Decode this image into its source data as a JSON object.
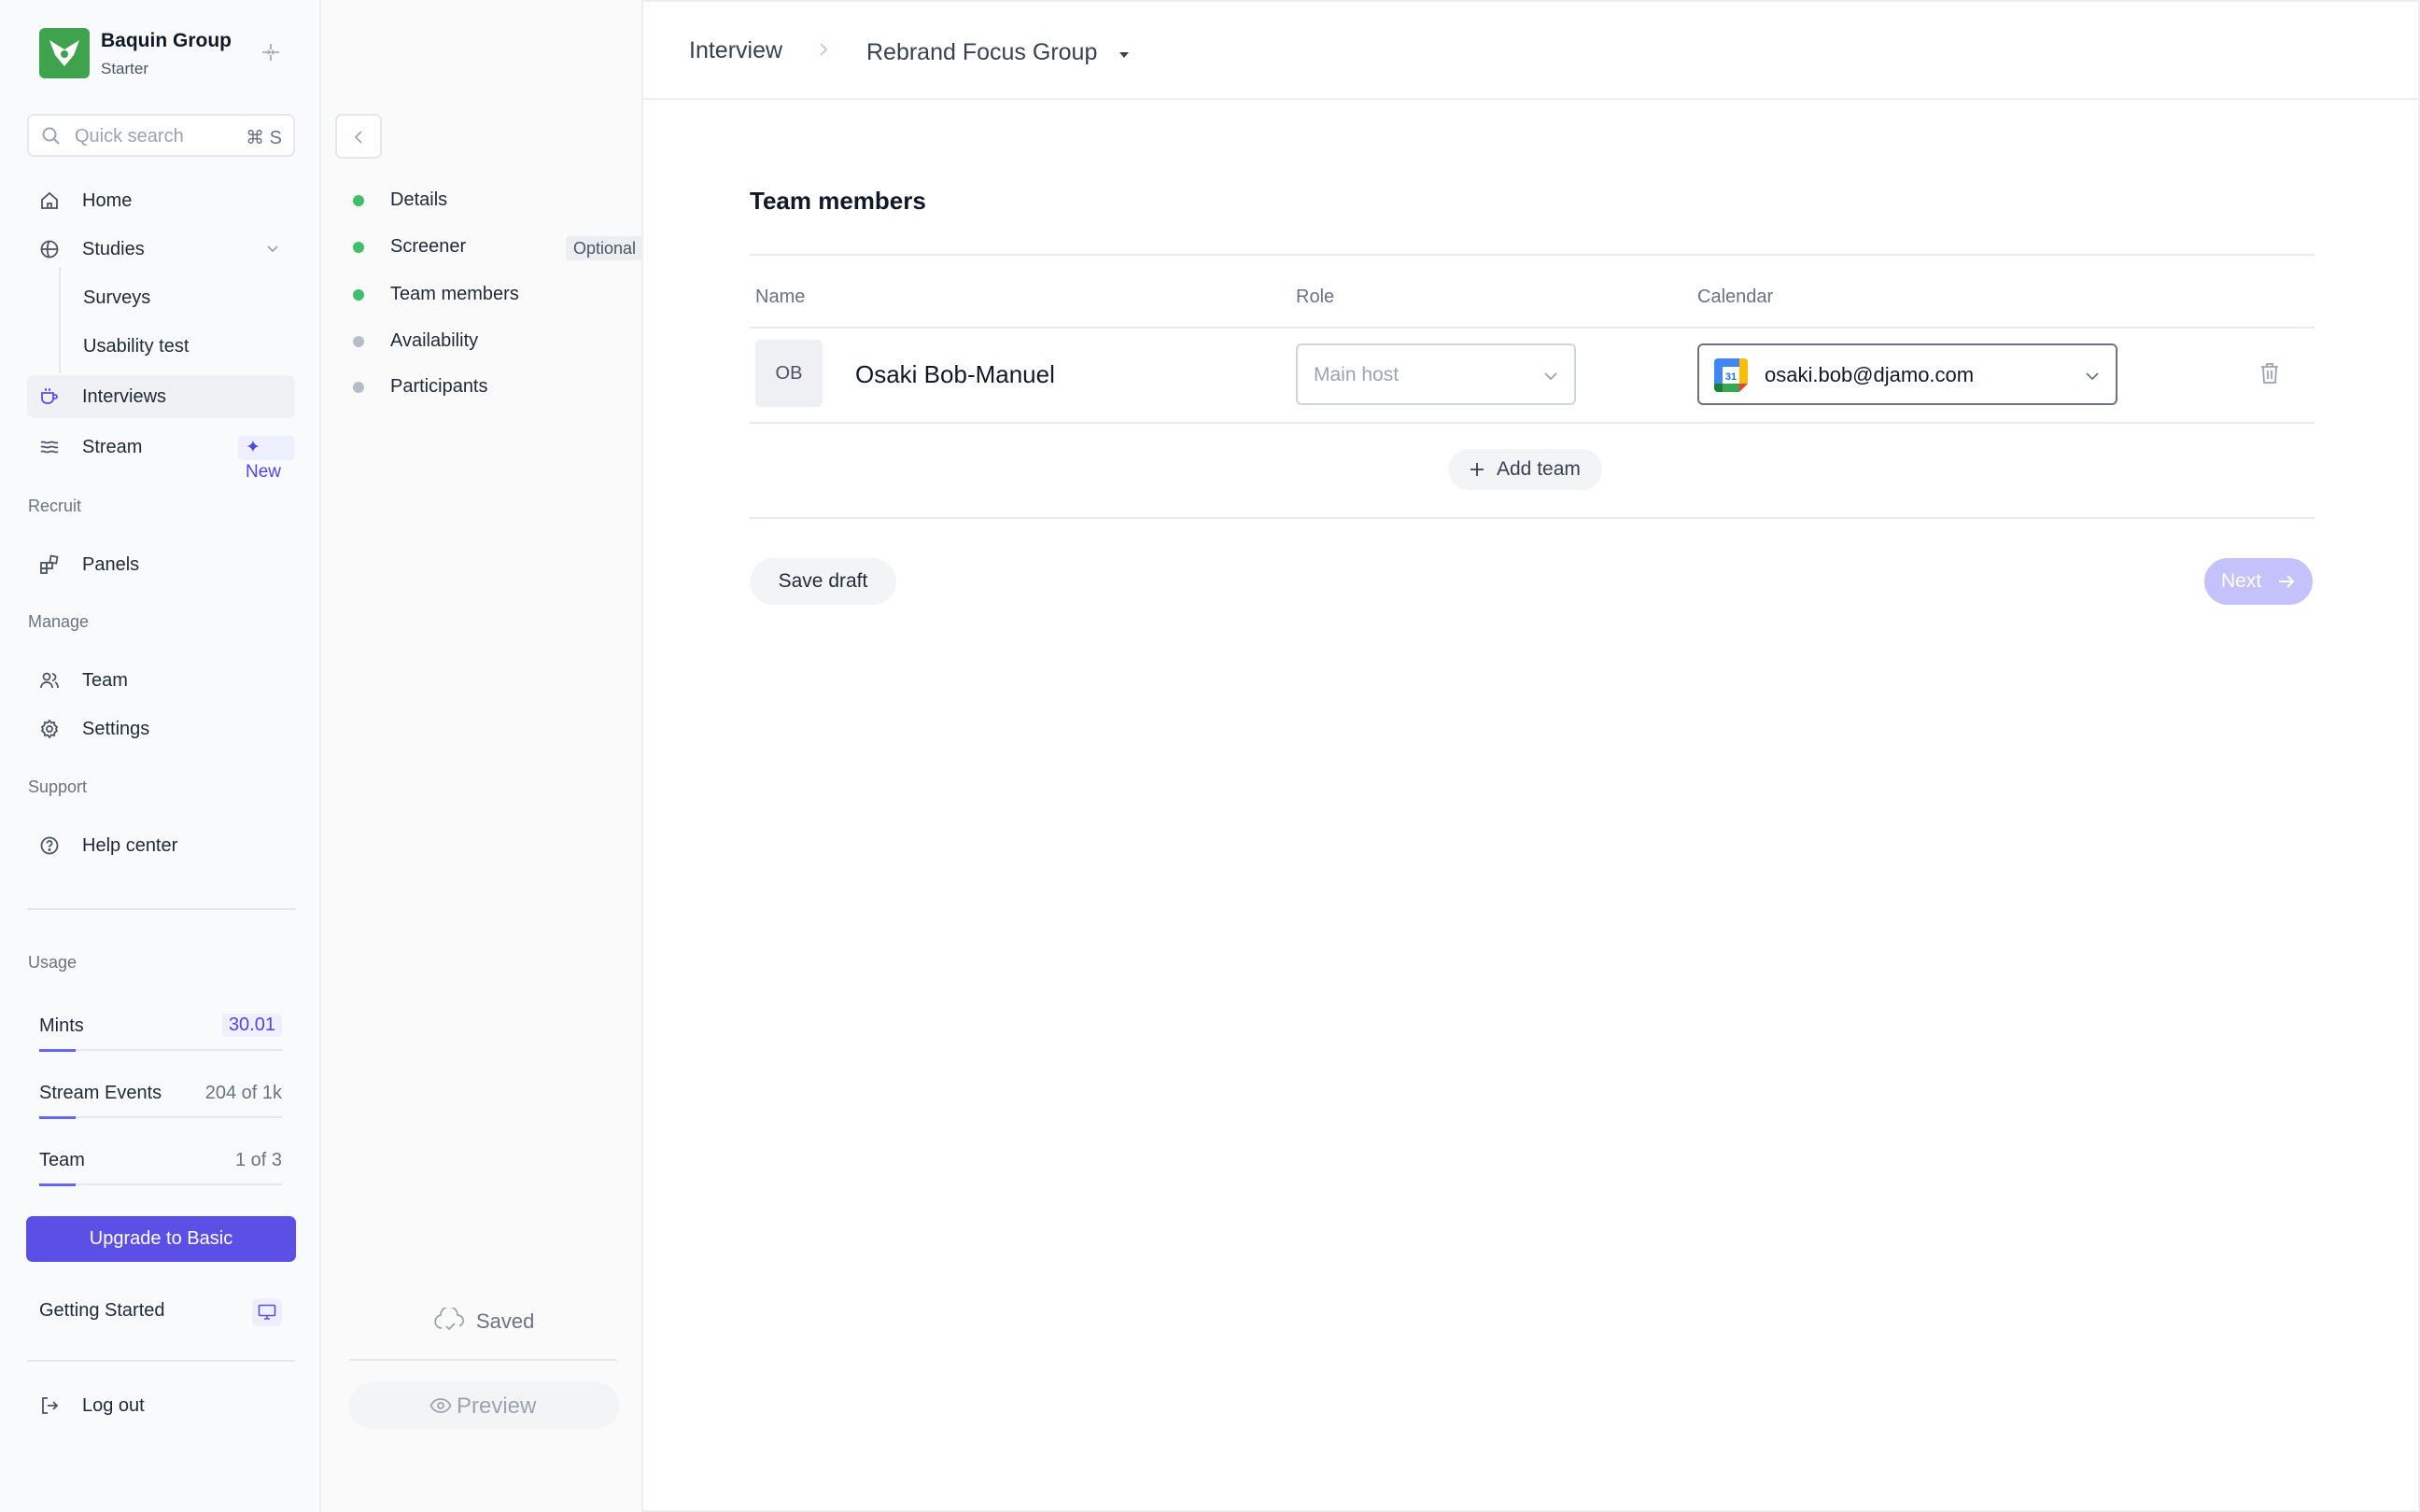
{
  "org": {
    "name": "Baquin Group",
    "plan": "Starter"
  },
  "search": {
    "placeholder": "Quick search",
    "shortcut": "⌘ S"
  },
  "nav": {
    "home": "Home",
    "studies": "Studies",
    "surveys": "Surveys",
    "usability_test": "Usability test",
    "interviews": "Interviews",
    "stream": "Stream",
    "stream_badge": "✦ New",
    "recruit_section": "Recruit",
    "panels": "Panels",
    "manage_section": "Manage",
    "team": "Team",
    "settings": "Settings",
    "support_section": "Support",
    "help_center": "Help center",
    "log_out": "Log out"
  },
  "usage": {
    "section": "Usage",
    "items": [
      {
        "label": "Mints",
        "value": "30.01",
        "fill": 0.15
      },
      {
        "label": "Stream Events",
        "value": "204 of 1k",
        "fill": 0.15
      },
      {
        "label": "Team",
        "value": "1 of 3",
        "fill": 0.15
      }
    ],
    "upgrade": "Upgrade to Basic",
    "getting_started": "Getting Started"
  },
  "steps": {
    "items": [
      {
        "label": "Details",
        "status": "complete",
        "color": "#3fbf6a"
      },
      {
        "label": "Screener",
        "status": "complete",
        "color": "#3fbf6a",
        "badge": "Optional"
      },
      {
        "label": "Team members",
        "status": "complete",
        "color": "#3fbf6a"
      },
      {
        "label": "Availability",
        "status": "pending",
        "color": "#b8bcc4"
      },
      {
        "label": "Participants",
        "status": "pending",
        "color": "#b8bcc4"
      }
    ],
    "saved": "Saved",
    "preview": "Preview"
  },
  "breadcrumb": {
    "parent": "Interview",
    "current": "Rebrand Focus Group"
  },
  "team_members": {
    "title": "Team members",
    "columns": [
      "Name",
      "Role",
      "Calendar"
    ],
    "rows": [
      {
        "initials": "OB",
        "name": "Osaki Bob-Manuel",
        "role_placeholder": "Main host",
        "calendar": "osaki.bob@djamo.com"
      }
    ],
    "add_team": "Add team",
    "save_draft": "Save draft",
    "next": "Next"
  },
  "colors": {
    "accent": "#5b4fe6",
    "brand_green": "#3fa34d",
    "next_disabled": "#c4c1fb"
  }
}
